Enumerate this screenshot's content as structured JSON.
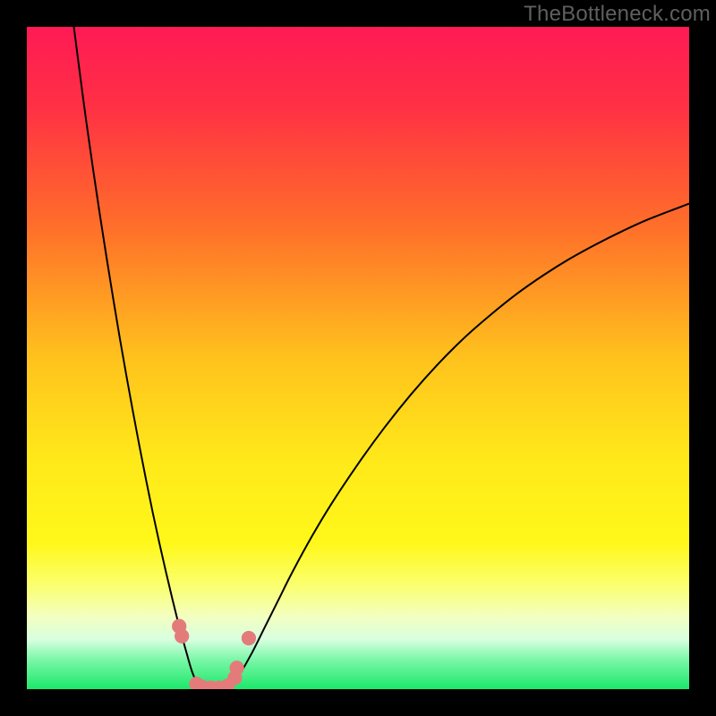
{
  "attribution": "TheBottleneck.com",
  "chart_data": {
    "type": "line",
    "title": "",
    "xlabel": "",
    "ylabel": "",
    "xlim": [
      0,
      100
    ],
    "ylim": [
      0,
      100
    ],
    "gradient_stops": [
      {
        "offset": 0.0,
        "color": "#ff1a55"
      },
      {
        "offset": 0.12,
        "color": "#ff3044"
      },
      {
        "offset": 0.3,
        "color": "#ff6e2a"
      },
      {
        "offset": 0.5,
        "color": "#ffc21d"
      },
      {
        "offset": 0.65,
        "color": "#ffe81a"
      },
      {
        "offset": 0.78,
        "color": "#fff81a"
      },
      {
        "offset": 0.84,
        "color": "#fbff6a"
      },
      {
        "offset": 0.89,
        "color": "#f3ffc0"
      },
      {
        "offset": 0.925,
        "color": "#d8ffe0"
      },
      {
        "offset": 0.955,
        "color": "#7cf7a8"
      },
      {
        "offset": 1.0,
        "color": "#1ce86b"
      }
    ],
    "series": [
      {
        "name": "left-curve",
        "x": [
          7.1,
          8,
          9,
          10,
          11,
          12,
          13,
          14,
          15,
          16,
          17,
          18,
          19,
          20,
          21,
          22,
          23,
          24,
          25,
          26,
          27
        ],
        "y": [
          100,
          93,
          85.5,
          78.5,
          71.8,
          65.4,
          59.2,
          53.2,
          47.5,
          42,
          36.7,
          31.6,
          26.7,
          22.1,
          17.7,
          13.5,
          9.5,
          5.9,
          2.5,
          0.5,
          0
        ]
      },
      {
        "name": "right-curve",
        "x": [
          30,
          31,
          32,
          34,
          36,
          38,
          40,
          43,
          46,
          50,
          54,
          58,
          62,
          66,
          70,
          74,
          78,
          82,
          86,
          90,
          94,
          100
        ],
        "y": [
          0,
          0.6,
          2,
          5.5,
          9.5,
          13.5,
          17.5,
          23,
          28,
          34,
          39.5,
          44.5,
          49,
          53,
          56.5,
          59.7,
          62.5,
          65,
          67.2,
          69.2,
          71,
          73.3
        ]
      }
    ],
    "markers": [
      {
        "x": 23.0,
        "y": 9.5,
        "r": 1.1
      },
      {
        "x": 23.4,
        "y": 8.0,
        "r": 1.1
      },
      {
        "x": 25.6,
        "y": 0.8,
        "r": 1.1
      },
      {
        "x": 26.5,
        "y": 0.35,
        "r": 1.1
      },
      {
        "x": 27.8,
        "y": 0.2,
        "r": 1.1
      },
      {
        "x": 29.0,
        "y": 0.2,
        "r": 1.1
      },
      {
        "x": 30.3,
        "y": 0.5,
        "r": 1.1
      },
      {
        "x": 31.4,
        "y": 1.7,
        "r": 1.1
      },
      {
        "x": 31.7,
        "y": 3.2,
        "r": 1.1
      },
      {
        "x": 33.5,
        "y": 7.7,
        "r": 1.1
      }
    ],
    "marker_color": "#e47b7b",
    "curve_color": "#000000",
    "curve_width": 2.0
  }
}
